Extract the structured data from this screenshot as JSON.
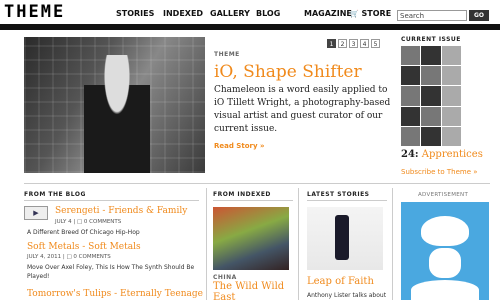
{
  "header": {
    "logo": "THEME",
    "nav": [
      "STORIES",
      "INDEXED",
      "GALLERY",
      "BLOG",
      "MAGAZINE",
      "STORE"
    ],
    "search_value": "Search",
    "go_label": "GO"
  },
  "hero": {
    "kicker": "THEME",
    "title": "iO, Shape Shifter",
    "dek": "Chameleon is a word easily applied to iO Tillett Wright, a photography-based visual artist and guest curator of our current issue.",
    "more": "Read Story »",
    "pages": [
      "1",
      "2",
      "3",
      "4",
      "5"
    ],
    "active_page": "1"
  },
  "current_issue": {
    "heading": "CURRENT ISSUE",
    "number": "24:",
    "title": "Apprentices",
    "subscribe": "Subscribe to Theme »"
  },
  "blog": {
    "heading": "FROM THE BLOG",
    "posts": [
      {
        "title": "Serengeti - Friends & Family",
        "date": "JULY 4",
        "comments": "0 COMMENTS",
        "excerpt": "A Different Breed Of Chicago Hip-Hop"
      },
      {
        "title": "Soft Metals - Soft Metals",
        "date": "JULY 4, 2011",
        "comments": "0 COMMENTS",
        "excerpt": "Move Over Axel Foley, This Is How The Synth Should Be"
      },
      {
        "title": "Tomorrow's Tulips - Eternally Teenage",
        "excerpt_2": "Played!"
      }
    ]
  },
  "indexed": {
    "heading": "FROM INDEXED",
    "kicker": "CHINA",
    "title_line1": "The Wild Wild",
    "title_line2": "East"
  },
  "latest": {
    "heading": "LATEST STORIES",
    "title": "Leap of Faith",
    "excerpt": "Anthony Lister talks about"
  },
  "ad": {
    "heading": "ADVERTISEMENT"
  },
  "colors": {
    "accent": "#f08a1c",
    "ad_blue": "#4aa8e0"
  }
}
